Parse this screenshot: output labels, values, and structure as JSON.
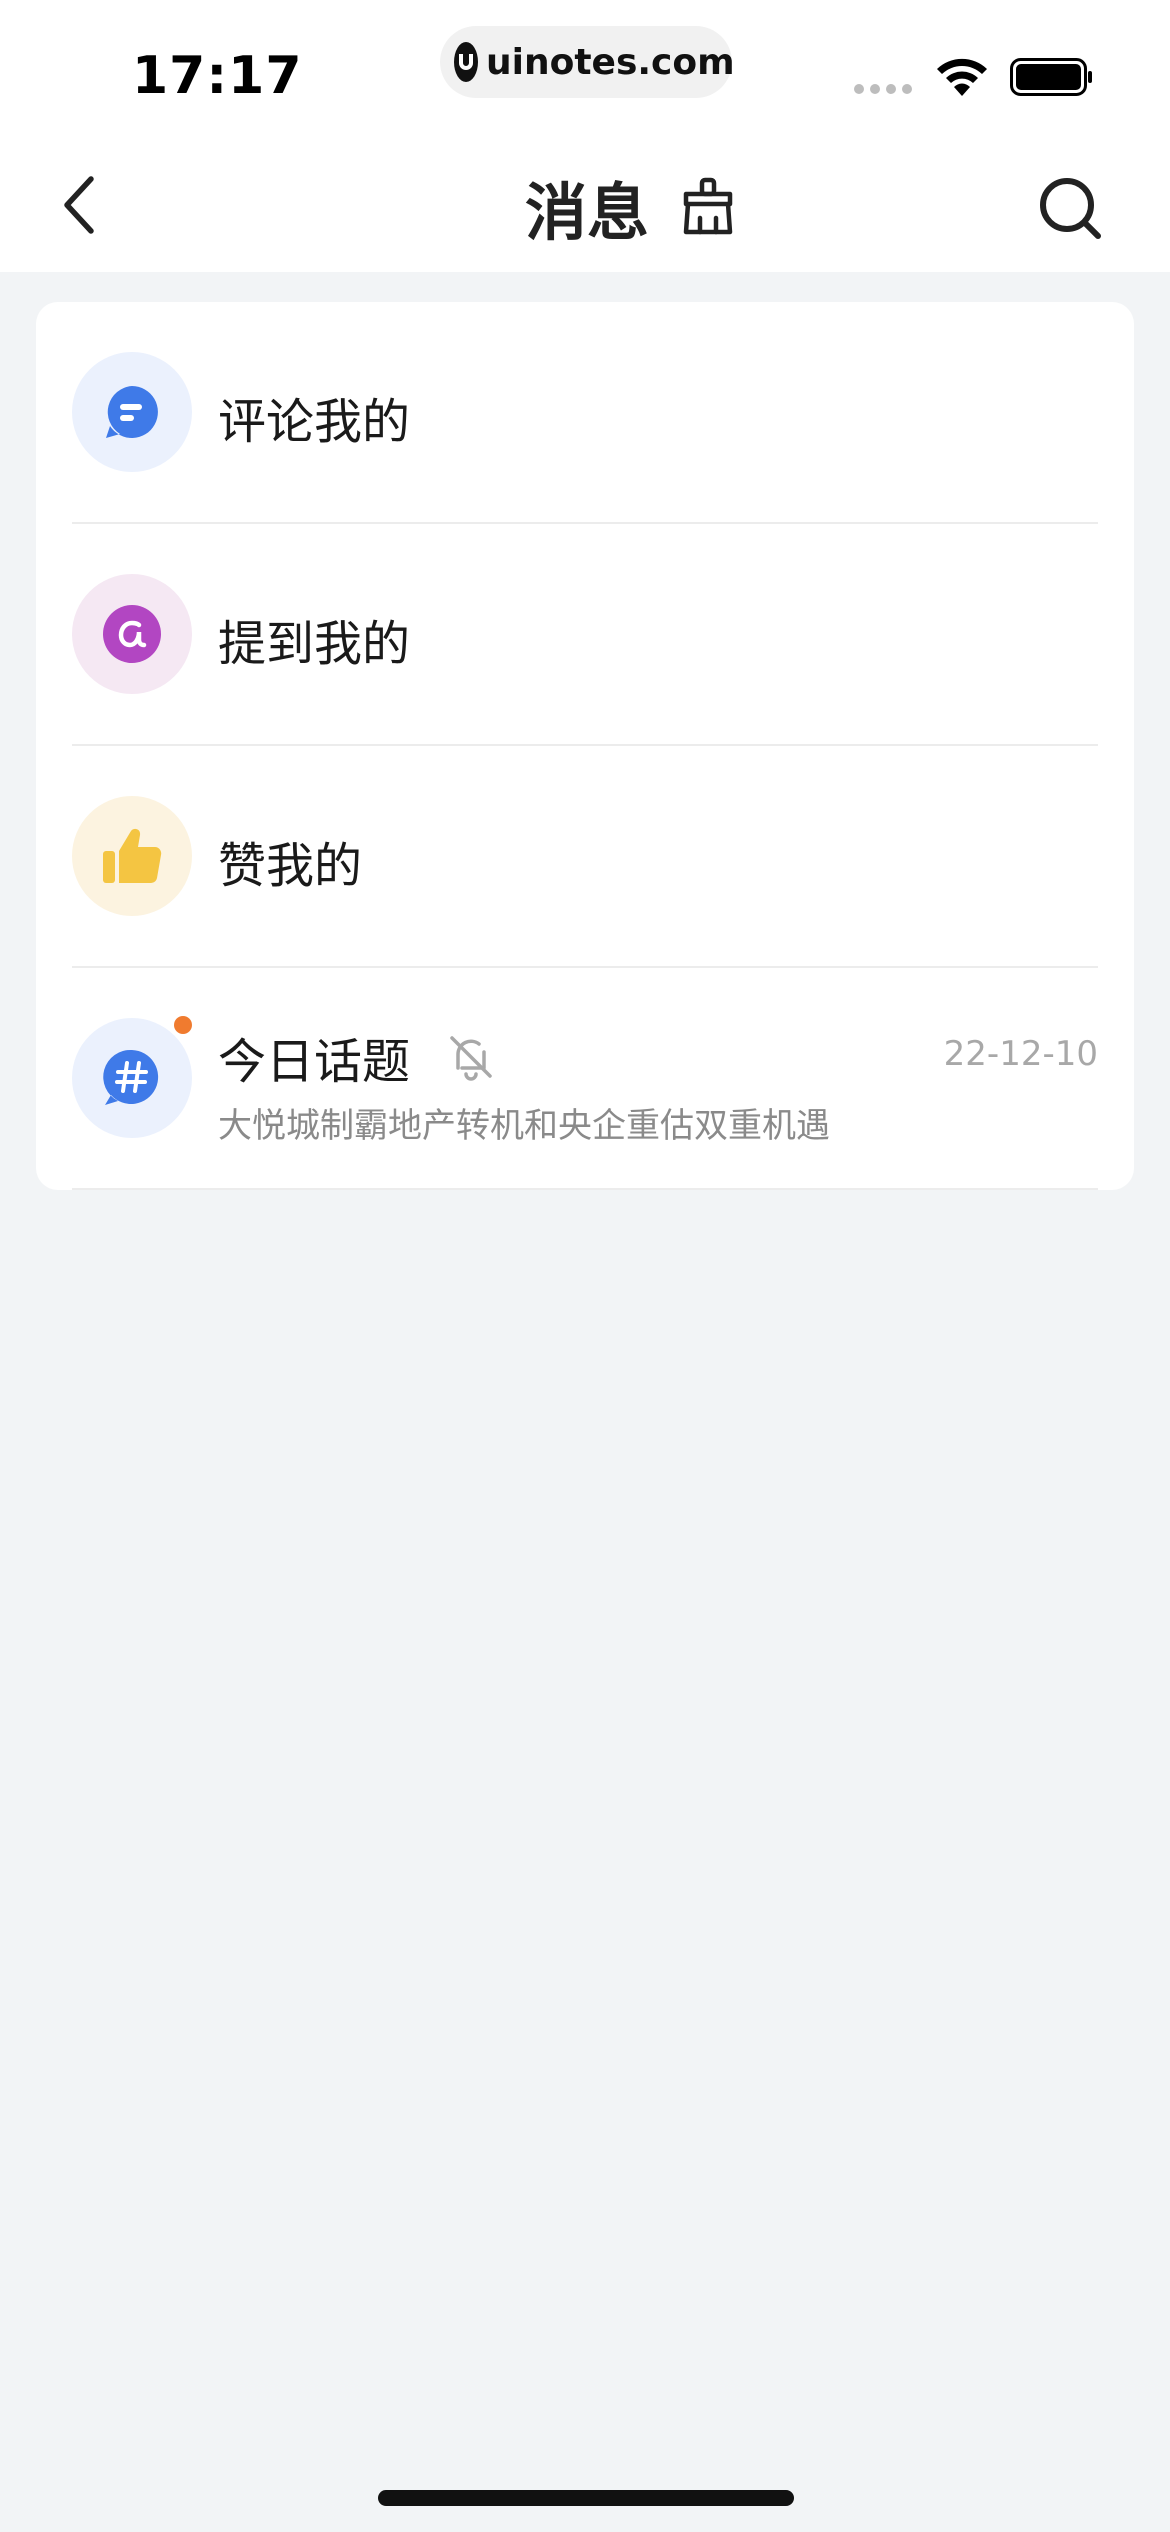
{
  "status_bar": {
    "time": "17:17",
    "watermark": "uinotes.com"
  },
  "nav": {
    "title": "消息",
    "back_icon": "chevron-left-icon",
    "clear_icon": "broom-icon",
    "search_icon": "search-icon"
  },
  "messages": [
    {
      "label": "评论我的",
      "icon": "comment-bubble-icon",
      "bg": "#ebf1fd",
      "color": "#3f7ae8"
    },
    {
      "label": "提到我的",
      "icon": "at-sign-icon",
      "bg": "#f5e8f3",
      "color": "#b246c2"
    },
    {
      "label": "赞我的",
      "icon": "thumbs-up-icon",
      "bg": "#fcf3e0",
      "color": "#f4c542"
    }
  ],
  "topic": {
    "title": "今日话题",
    "subtitle": "大悦城制霸地产转机和央企重估双重机遇",
    "time": "22-12-10",
    "icon": "hashtag-icon",
    "mute_icon": "bell-off-icon",
    "unread": true,
    "colors": {
      "bg": "#ebf1fd",
      "icon": "#3f7ae8",
      "dot": "#f07b2f"
    }
  }
}
